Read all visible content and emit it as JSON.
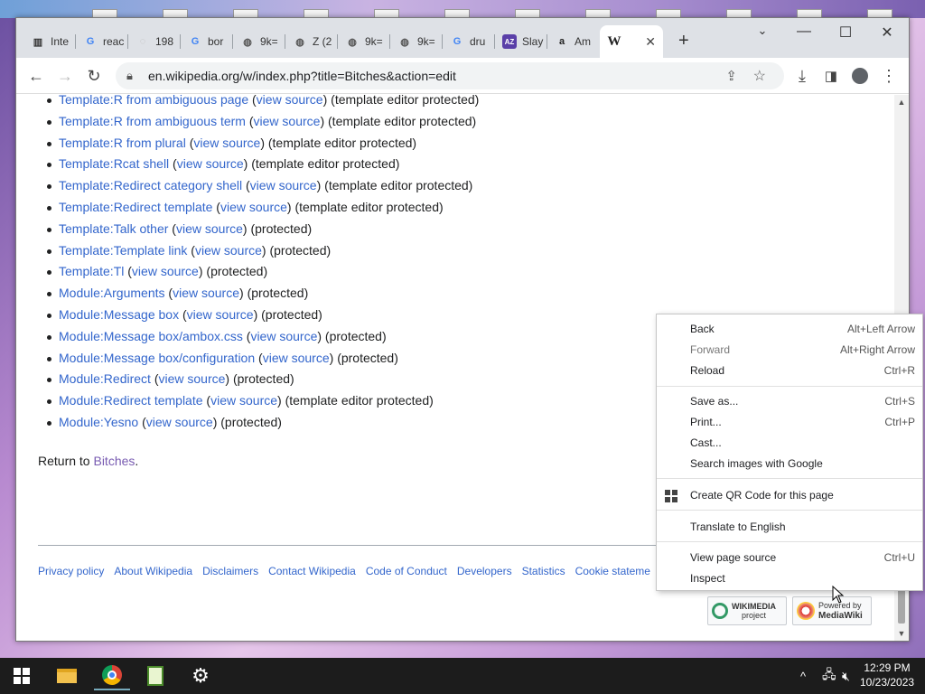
{
  "browser": {
    "tabs": [
      {
        "label": "Inte",
        "icon": "news-icon",
        "fav_char": "▥",
        "fav_color": "#333"
      },
      {
        "label": "reac",
        "icon": "google-icon",
        "fav_char": "G",
        "fav_color": "#4285f4"
      },
      {
        "label": "198",
        "icon": "loading-icon",
        "fav_char": "◌",
        "fav_color": "#999"
      },
      {
        "label": "bor",
        "icon": "google-icon",
        "fav_char": "G",
        "fav_color": "#4285f4"
      },
      {
        "label": "9k=",
        "icon": "globe-icon",
        "fav_char": "◍",
        "fav_color": "#555"
      },
      {
        "label": "Z (2",
        "icon": "globe-icon",
        "fav_char": "◍",
        "fav_color": "#555"
      },
      {
        "label": "9k=",
        "icon": "globe-icon",
        "fav_char": "◍",
        "fav_color": "#555"
      },
      {
        "label": "9k=",
        "icon": "globe-icon",
        "fav_char": "◍",
        "fav_color": "#555"
      },
      {
        "label": "dru",
        "icon": "google-icon",
        "fav_char": "G",
        "fav_color": "#4285f4"
      },
      {
        "label": "Slay",
        "icon": "az-icon",
        "fav_char": "AZ",
        "fav_color": "#5a3fa8"
      },
      {
        "label": "Am",
        "icon": "amazon-icon",
        "fav_char": "a",
        "fav_color": "#222"
      },
      {
        "label": "",
        "icon": "wikipedia-icon",
        "fav_char": "W",
        "fav_color": "#222",
        "active": true
      }
    ],
    "new_tab_symbol": "+",
    "url": "en.wikipedia.org/w/index.php?title=Bitches&action=edit"
  },
  "page": {
    "items": [
      {
        "link": "Template:R from ambiguous page",
        "source": "view source",
        "status": "(template editor protected)"
      },
      {
        "link": "Template:R from ambiguous term",
        "source": "view source",
        "status": "(template editor protected)"
      },
      {
        "link": "Template:R from plural",
        "source": "view source",
        "status": "(template editor protected)"
      },
      {
        "link": "Template:Rcat shell",
        "source": "view source",
        "status": "(template editor protected)"
      },
      {
        "link": "Template:Redirect category shell",
        "source": "view source",
        "status": "(template editor protected)"
      },
      {
        "link": "Template:Redirect template",
        "source": "view source",
        "status": "(template editor protected)"
      },
      {
        "link": "Template:Talk other",
        "source": "view source",
        "status": "(protected)"
      },
      {
        "link": "Template:Template link",
        "source": "view source",
        "status": "(protected)"
      },
      {
        "link": "Template:Tl",
        "source": "view source",
        "status": "(protected)"
      },
      {
        "link": "Module:Arguments",
        "source": "view source",
        "status": "(protected)"
      },
      {
        "link": "Module:Message box",
        "source": "view source",
        "status": "(protected)"
      },
      {
        "link": "Module:Message box/ambox.css",
        "source": "view source",
        "status": "(protected)"
      },
      {
        "link": "Module:Message box/configuration",
        "source": "view source",
        "status": "(protected)"
      },
      {
        "link": "Module:Redirect",
        "source": "view source",
        "status": "(protected)"
      },
      {
        "link": "Module:Redirect template",
        "source": "view source",
        "status": "(template editor protected)"
      },
      {
        "link": "Module:Yesno",
        "source": "view source",
        "status": "(protected)"
      }
    ],
    "return_prefix": "Return to ",
    "return_link": "Bitches",
    "return_suffix": ".",
    "footer_links": [
      "Privacy policy",
      "About Wikipedia",
      "Disclaimers",
      "Contact Wikipedia",
      "Code of Conduct",
      "Developers",
      "Statistics",
      "Cookie stateme"
    ],
    "wikimedia_badge": {
      "line1": "WIKIMEDIA",
      "line2": "project"
    },
    "mediawiki_badge": {
      "line1": "Powered by",
      "line2": "MediaWiki"
    }
  },
  "context_menu": {
    "items": [
      {
        "label": "Back",
        "shortcut": "Alt+Left Arrow"
      },
      {
        "label": "Forward",
        "shortcut": "Alt+Right Arrow",
        "disabled": true
      },
      {
        "label": "Reload",
        "shortcut": "Ctrl+R"
      },
      {
        "label": "Save as...",
        "shortcut": "Ctrl+S"
      },
      {
        "label": "Print...",
        "shortcut": "Ctrl+P"
      },
      {
        "label": "Cast...",
        "shortcut": ""
      },
      {
        "label": "Search images with Google",
        "shortcut": ""
      },
      {
        "label": "Create QR Code for this page",
        "shortcut": ""
      },
      {
        "label": "Translate to English",
        "shortcut": ""
      },
      {
        "label": "View page source",
        "shortcut": "Ctrl+U"
      },
      {
        "label": "Inspect",
        "shortcut": ""
      }
    ]
  },
  "taskbar": {
    "time": "12:29 PM",
    "date": "10/23/2023",
    "apps": [
      "start-icon",
      "file-explorer-icon",
      "chrome-icon",
      "spreadsheet-icon",
      "settings-icon"
    ]
  },
  "colors": {
    "link": "#3366cc",
    "visited": "#795cb2",
    "taskbar": "#1c1c1c"
  }
}
